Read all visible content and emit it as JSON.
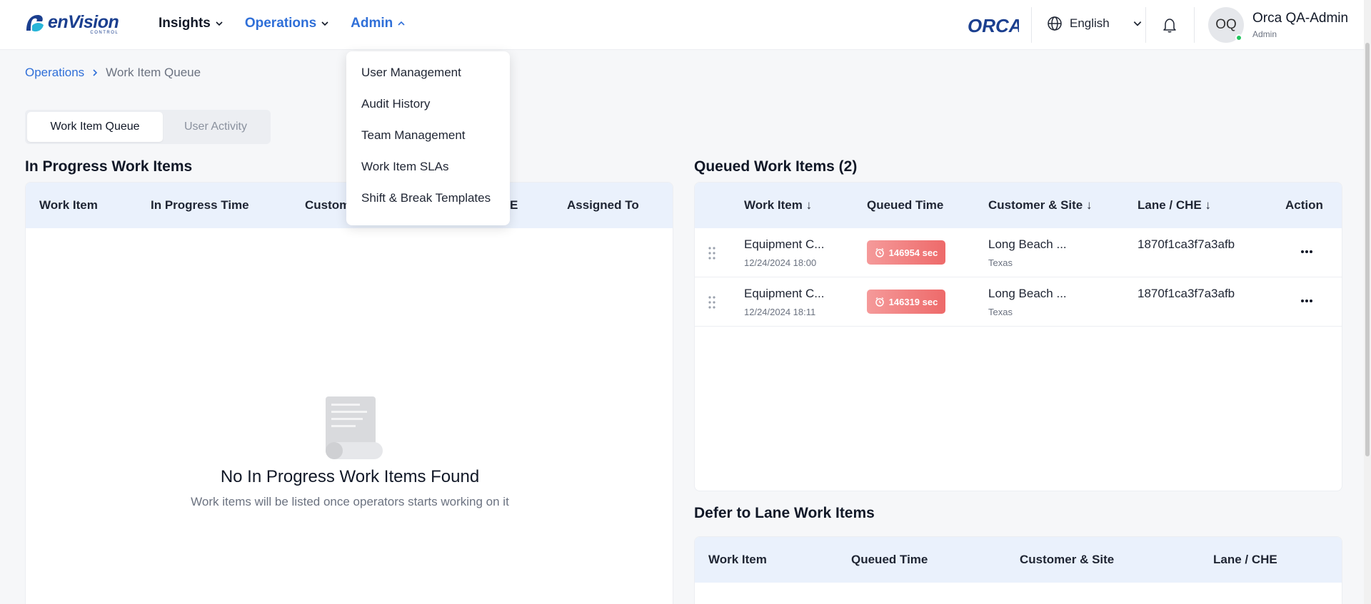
{
  "brand": {
    "name": "enVision",
    "sub": "CONTROL",
    "partner_logo": "ORCA"
  },
  "nav": {
    "items": [
      {
        "label": "Insights",
        "icon": "chevron-down-icon"
      },
      {
        "label": "Operations",
        "icon": "chevron-down-icon"
      },
      {
        "label": "Admin",
        "icon": "chevron-up-icon"
      }
    ]
  },
  "header": {
    "language": "English",
    "user_initials": "OQ",
    "user_name": "Orca QA-Admin",
    "user_role": "Admin"
  },
  "breadcrumb": {
    "parent": "Operations",
    "current": "Work Item Queue"
  },
  "tabs": {
    "active": "Work Item Queue",
    "other": "User Activity"
  },
  "in_progress": {
    "title": "In Progress Work Items",
    "columns": [
      "Work Item",
      "In Progress Time",
      "Custom",
      "E",
      "Assigned To"
    ],
    "empty_title": "No In Progress Work Items Found",
    "empty_subtitle": "Work items will be listed once operators starts working on it"
  },
  "queued": {
    "title": "Queued Work Items (2)",
    "columns": [
      "Work Item ↓",
      "Queued Time",
      "Customer & Site ↓",
      "Lane / CHE ↓",
      "Action"
    ],
    "rows": [
      {
        "work_item": "Equipment C...",
        "date": "12/24/2024 18:00",
        "queued_time": "146954 sec",
        "customer": "Long Beach ...",
        "site": "Texas",
        "lane": "1870f1ca3f7a3afb"
      },
      {
        "work_item": "Equipment C...",
        "date": "12/24/2024 18:11",
        "queued_time": "146319 sec",
        "customer": "Long Beach ...",
        "site": "Texas",
        "lane": "1870f1ca3f7a3afb"
      }
    ]
  },
  "defer": {
    "title": "Defer to Lane Work Items",
    "columns": [
      "Work Item",
      "Queued Time",
      "Customer & Site",
      "Lane / CHE"
    ]
  },
  "admin_menu": {
    "items": [
      "User Management",
      "Audit History",
      "Team Management",
      "Work Item SLAs",
      "Shift & Break Templates"
    ]
  },
  "colors": {
    "accent": "#2f6fd8",
    "brand": "#1b3f8f",
    "badge": "#ee6a6a",
    "table_header": "#eaf1fc"
  }
}
